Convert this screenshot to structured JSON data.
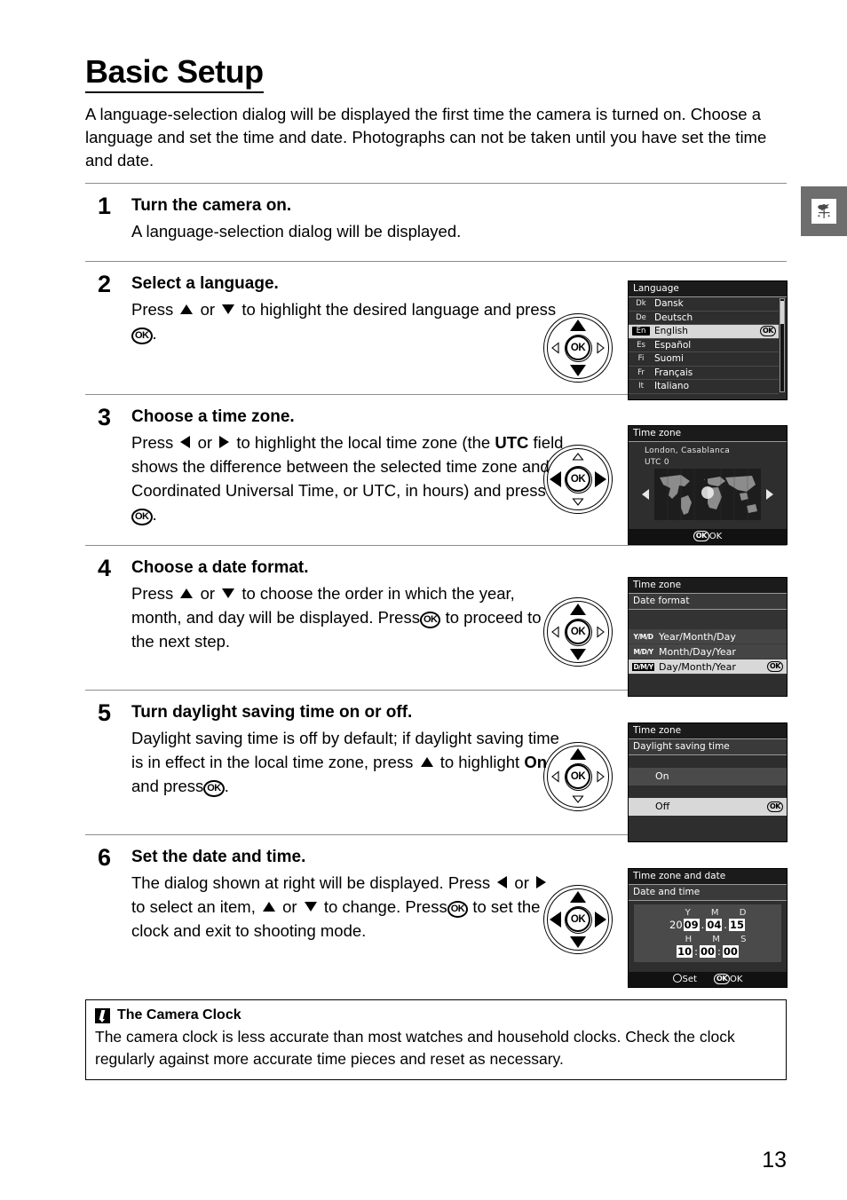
{
  "page": {
    "title": "Basic Setup",
    "intro": "A language-selection dialog will be displayed the first time the camera is turned on.  Choose a language and set the time and date.  Photographs can not be taken until you have set the time and date.",
    "page_number": "13",
    "side_tab_icon": "weather-vane-icon"
  },
  "steps": [
    {
      "number": "1",
      "heading": "Turn the camera on.",
      "text": "A language-selection dialog will be displayed."
    },
    {
      "number": "2",
      "heading": "Select a language.",
      "text_a": "Press",
      "text_b": "or",
      "text_c": "to highlight the desired language and press",
      "text_d": "."
    },
    {
      "number": "3",
      "heading": "Choose a time zone.",
      "text_a": "Press",
      "text_b": "or",
      "text_c": "to highlight the local time zone (the",
      "bold": "UTC",
      "text_d": "field shows the difference between the selected time zone and Coordinated Universal Time, or UTC, in hours) and press",
      "text_e": "."
    },
    {
      "number": "4",
      "heading": "Choose a date format.",
      "text_a": "Press",
      "text_b": "or",
      "text_c": "to choose the order in which the year, month, and day will be displayed.  Press",
      "text_d": "to proceed to the next step."
    },
    {
      "number": "5",
      "heading": "Turn daylight saving time on or off.",
      "text_a": "Daylight saving time is off by default; if daylight saving time is in effect in the local time zone, press",
      "text_b": "to highlight",
      "bold": "On",
      "text_c": "and press",
      "text_d": "."
    },
    {
      "number": "6",
      "heading": "Set the date and time.",
      "text_a": "The dialog shown at right will be displayed. Press",
      "text_b": "or",
      "text_c": "to select an item,",
      "text_d": "or",
      "text_e": "to change. Press",
      "text_f": "to set the clock and exit to shooting mode."
    }
  ],
  "ok_label": "OK",
  "screens": {
    "language": {
      "title": "Language",
      "rows": [
        {
          "code": "Dk",
          "label": "Dansk",
          "selected": false
        },
        {
          "code": "De",
          "label": "Deutsch",
          "selected": false
        },
        {
          "code": "En",
          "label": "English",
          "selected": true
        },
        {
          "code": "Es",
          "label": "Español",
          "selected": false
        },
        {
          "code": "Fi",
          "label": "Suomi",
          "selected": false
        },
        {
          "code": "Fr",
          "label": "Français",
          "selected": false
        },
        {
          "code": "It",
          "label": "Italiano",
          "selected": false
        }
      ]
    },
    "timezone": {
      "title": "Time zone",
      "city": "London, Casablanca",
      "utc": "UTC  0",
      "footer_ok": "OK"
    },
    "dateformat": {
      "title": "Time zone",
      "subtitle": "Date format",
      "rows": [
        {
          "code": "Y/M/D",
          "label": "Year/Month/Day",
          "selected": false
        },
        {
          "code": "M/D/Y",
          "label": "Month/Day/Year",
          "selected": false
        },
        {
          "code": "D/M/Y",
          "label": "Day/Month/Year",
          "selected": true
        }
      ]
    },
    "dst": {
      "title": "Time zone",
      "subtitle": "Daylight saving time",
      "rows": [
        {
          "label": "On",
          "selected": false
        },
        {
          "label": "Off",
          "selected": true
        }
      ]
    },
    "datetime": {
      "title": "Time zone and date",
      "subtitle": "Date and time",
      "date_labels": "Y   M   D",
      "time_labels": "H   M   S",
      "year_prefix": "20",
      "year": "09",
      "month": "04",
      "day": "15",
      "hour": "10",
      "minute": "00",
      "second": "00",
      "footer_set": "Set",
      "footer_ok": "OK"
    }
  },
  "note": {
    "icon": "pencil-icon",
    "heading": "The Camera Clock",
    "text": "The camera clock is less accurate than most watches and household clocks.  Check the clock regularly against more accurate time pieces and reset as necessary."
  }
}
